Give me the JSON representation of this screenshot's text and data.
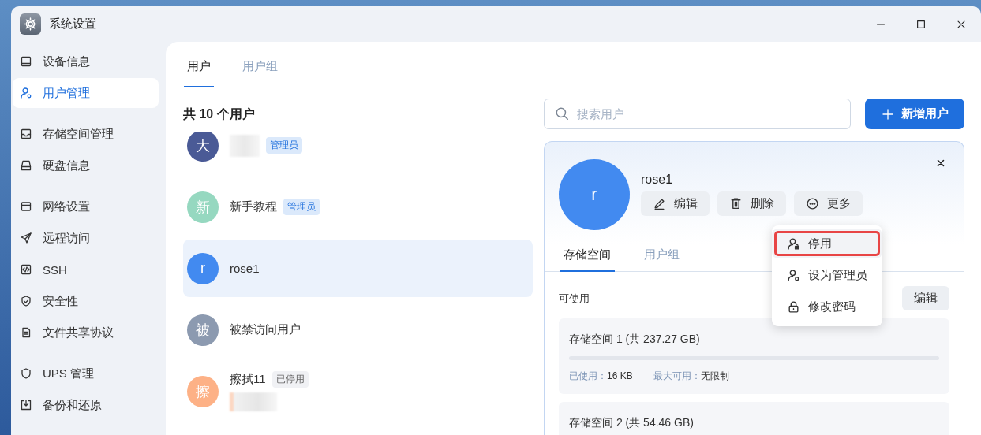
{
  "window": {
    "title": "系统设置"
  },
  "sidebar": {
    "groups": [
      {
        "items": [
          {
            "label": "设备信息",
            "selected": false
          },
          {
            "label": "用户管理",
            "selected": true
          }
        ]
      },
      {
        "items": [
          {
            "label": "存储空间管理",
            "selected": false
          },
          {
            "label": "硬盘信息",
            "selected": false
          }
        ]
      },
      {
        "items": [
          {
            "label": "网络设置",
            "selected": false
          },
          {
            "label": "远程访问",
            "selected": false
          },
          {
            "label": "SSH",
            "selected": false
          },
          {
            "label": "安全性",
            "selected": false
          },
          {
            "label": "文件共享协议",
            "selected": false
          }
        ]
      },
      {
        "items": [
          {
            "label": "UPS 管理",
            "selected": false
          },
          {
            "label": "备份和还原",
            "selected": false
          }
        ]
      }
    ]
  },
  "tabs": [
    {
      "label": "用户",
      "selected": true
    },
    {
      "label": "用户组",
      "selected": false
    }
  ],
  "user_list": {
    "count_label": "共 10 个用户",
    "items": [
      {
        "avatar": "大",
        "color": "#4a5a96",
        "name_hidden": true,
        "badge": {
          "text": "管理员",
          "kind": "admin"
        },
        "subtitle_hidden": false,
        "selected": false
      },
      {
        "avatar": "新",
        "color": "#96d8c0",
        "name": "新手教程",
        "name_hidden": false,
        "badge": {
          "text": "管理员",
          "kind": "admin"
        },
        "subtitle_hidden": false,
        "selected": false
      },
      {
        "avatar": "r",
        "color": "#428af0",
        "name": "rose1",
        "name_hidden": false,
        "subtitle_hidden": false,
        "selected": true
      },
      {
        "avatar": "被",
        "color": "#8c9ab0",
        "name": "被禁访问用户",
        "name_hidden": false,
        "subtitle_hidden": false,
        "selected": false
      },
      {
        "avatar": "擦",
        "color": "#fdb186",
        "name": "擦拭11",
        "name_hidden": false,
        "badge": {
          "text": "已停用",
          "kind": "disabled"
        },
        "subtitle_hidden": true,
        "selected": false
      }
    ]
  },
  "search": {
    "placeholder": "搜索用户"
  },
  "add_button": {
    "label": "新增用户"
  },
  "detail": {
    "avatar": "r",
    "name": "rose1",
    "actions": [
      {
        "label": "编辑"
      },
      {
        "label": "删除"
      },
      {
        "label": "更多"
      }
    ],
    "tabs": [
      {
        "label": "存储空间",
        "selected": true
      },
      {
        "label": "用户组",
        "selected": false
      }
    ],
    "available_label": "可使用",
    "edit_label": "编辑",
    "storage": [
      {
        "title": "存储空间 1 (共 237.27 GB)",
        "level": 0,
        "used_label": "已使用：",
        "used_value": "16 KB",
        "max_label": "最大可用：",
        "max_value": "无限制"
      },
      {
        "title": "存储空间 2 (共 54.46 GB)"
      }
    ],
    "menu": [
      {
        "label": "停用",
        "hovered": true,
        "highlighted": true
      },
      {
        "label": "设为管理员",
        "hovered": false,
        "highlighted": false
      },
      {
        "label": "修改密码",
        "hovered": false,
        "highlighted": false
      }
    ]
  }
}
